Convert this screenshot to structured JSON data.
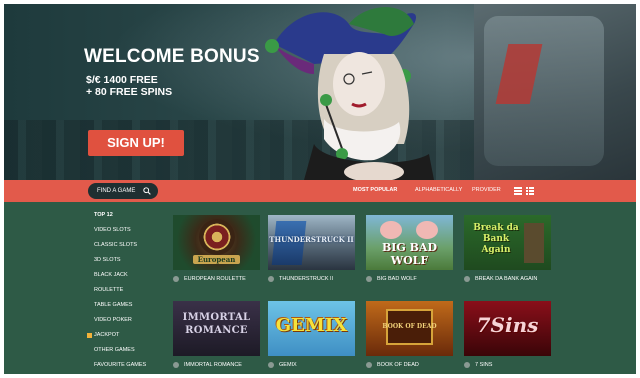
{
  "hero": {
    "title": "WELCOME BONUS",
    "line1": "$/€ 1400 FREE",
    "line2": "+ 80 FREE SPINS",
    "signup_label": "SIGN UP!",
    "accent_color": "#e0513f"
  },
  "navbar": {
    "search_label": "FIND A GAME",
    "tabs": [
      {
        "label": "MOST POPULAR",
        "active": true
      },
      {
        "label": "ALPHABETICALLY",
        "active": false
      },
      {
        "label": "PROVIDER",
        "active": false
      }
    ],
    "bar_color": "#e25a4b"
  },
  "sidebar": {
    "items": [
      "TOP 12",
      "VIDEO SLOTS",
      "CLASSIC SLOTS",
      "3D SLOTS",
      "BLACK JACK",
      "ROULETTE",
      "TABLE GAMES",
      "VIDEO POKER",
      "JACKPOT",
      "OTHER GAMES",
      "FAVOURITE GAMES"
    ]
  },
  "games": [
    {
      "title": "EUROPEAN ROULETTE",
      "thumb_text": "European"
    },
    {
      "title": "THUNDERSTRUCK II",
      "thumb_text": "THUNDERSTRUCK II"
    },
    {
      "title": "BIG BAD WOLF",
      "thumb_text": "BIG BAD WOLF"
    },
    {
      "title": "BREAK DA BANK AGAIN",
      "thumb_text": "Break da Bank Again"
    },
    {
      "title": "IMMORTAL ROMANCE",
      "thumb_text": "IMMORTAL ROMANCE"
    },
    {
      "title": "GEMIX",
      "thumb_text": "GEMIX"
    },
    {
      "title": "BOOK OF DEAD",
      "thumb_text": "BOOK OF DEAD"
    },
    {
      "title": "7 SINS",
      "thumb_text": "7Sins"
    }
  ],
  "colors": {
    "main_bg": "#2e5a46",
    "hero_bg": "#2d4a4c"
  }
}
